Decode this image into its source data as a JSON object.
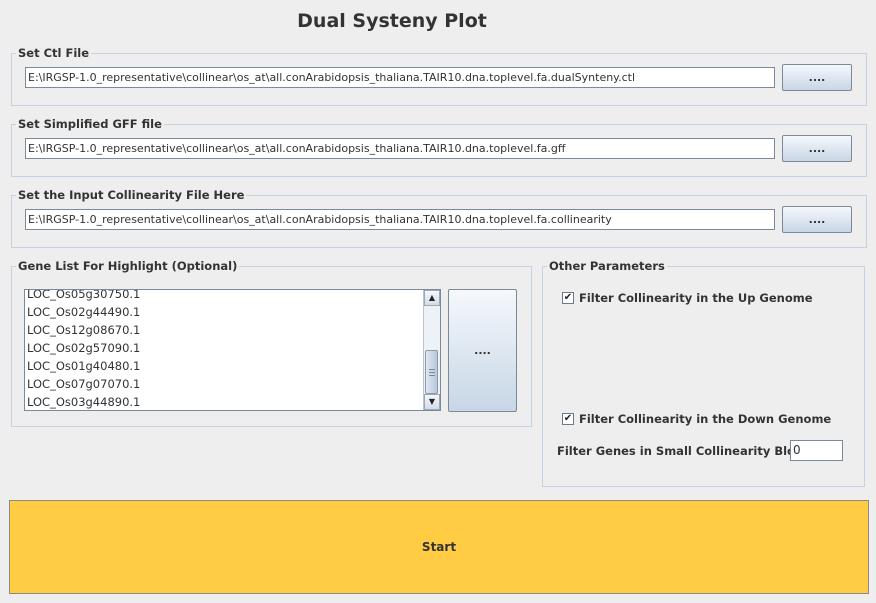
{
  "title": "Dual Systeny Plot",
  "ctl_section": {
    "legend": "Set Ctl File",
    "path": "E:\\IRGSP-1.0_representative\\collinear\\os_at\\all.conArabidopsis_thaliana.TAIR10.dna.toplevel.fa.dualSynteny.ctl",
    "browse_label": "...."
  },
  "gff_section": {
    "legend": "Set Simplified GFF file",
    "path": "E:\\IRGSP-1.0_representative\\collinear\\os_at\\all.conArabidopsis_thaliana.TAIR10.dna.toplevel.fa.gff",
    "browse_label": "...."
  },
  "collinearity_section": {
    "legend": "Set the Input Collinearity File Here",
    "path": "E:\\IRGSP-1.0_representative\\collinear\\os_at\\all.conArabidopsis_thaliana.TAIR10.dna.toplevel.fa.collinearity",
    "browse_label": "...."
  },
  "gene_list_section": {
    "legend": "Gene List For Highlight (Optional)",
    "genes": [
      "LOC_Os05g30750.1",
      "LOC_Os02g44490.1",
      "LOC_Os12g08670.1",
      "LOC_Os02g57090.1",
      "LOC_Os01g40480.1",
      "LOC_Os07g07070.1",
      "LOC_Os03g44890.1"
    ],
    "browse_label": "...."
  },
  "other_params": {
    "legend": "Other Parameters",
    "filter_up_label": "Filter Collinearity in the Up Genome",
    "filter_up_checked": true,
    "filter_down_label": "Filter Collinearity in the Down Genome",
    "filter_down_checked": true,
    "small_block_label": "Filter Genes in Small Collinearity Block :",
    "small_block_value": "0"
  },
  "start_label": "Start",
  "icons": {
    "check": "check-mark",
    "scroll_up": "triangle-up",
    "scroll_down": "triangle-down"
  }
}
